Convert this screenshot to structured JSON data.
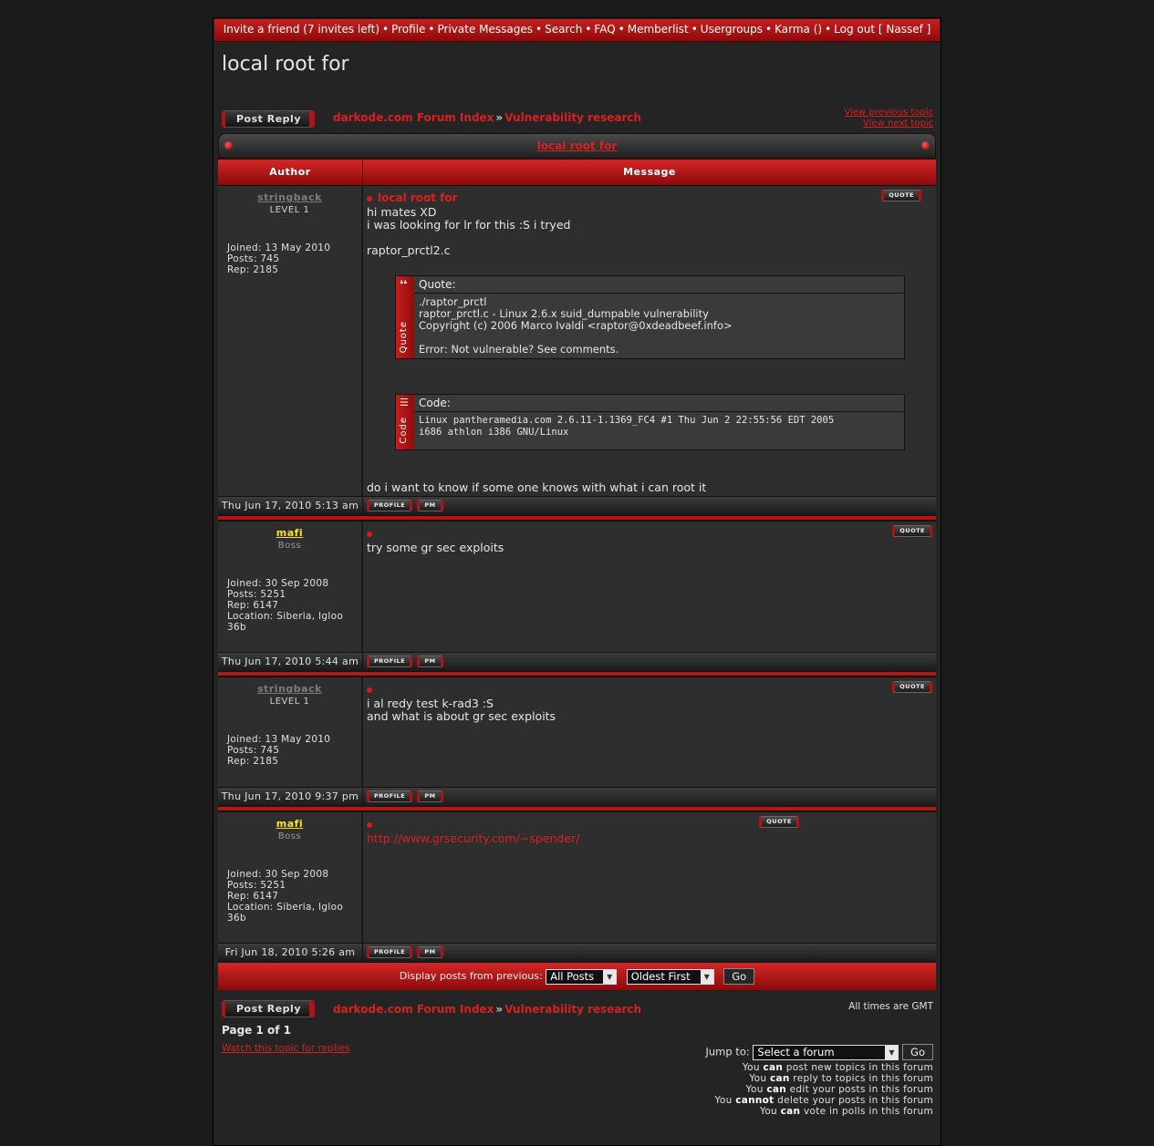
{
  "nav": {
    "items": [
      "Invite a friend (7 invites left)",
      "Profile",
      "Private Messages",
      "Search",
      "FAQ",
      "Memberlist",
      "Usergroups",
      "Karma ()",
      "Log out [ Nassef ]"
    ],
    "sep": "•"
  },
  "page_title": "local root for",
  "post_reply_label": "Post Reply",
  "breadcrumb": {
    "index": "darkode.com Forum Index",
    "arrow": "»",
    "forum": "Vulnerability research"
  },
  "topic_nav": {
    "prev": "View previous topic",
    "next": "View next topic"
  },
  "caption": "local root for",
  "headers": {
    "author": "Author",
    "message": "Message"
  },
  "buttons": {
    "quote": "QUOTE",
    "profile": "PROFILE",
    "pm": "PM"
  },
  "posts": [
    {
      "author": "stringback",
      "rank": "LEVEL 1",
      "joined": "Joined: 13 May 2010",
      "posts": "Posts: 745",
      "rep": "Rep: 2185",
      "subject": "local root for",
      "lines": [
        "hi mates XD",
        "i was looking for lr for this :S i tryed",
        "raptor_prctl2.c"
      ],
      "quote": {
        "label": "Quote:",
        "side": "Quote",
        "lines": [
          "./raptor_prctl",
          "raptor_prctl.c - Linux 2.6.x suid_dumpable vulnerability",
          "Copyright (c) 2006 Marco Ivaldi <raptor@0xdeadbeef.info>",
          "Error: Not vulnerable? See comments."
        ]
      },
      "code": {
        "label": "Code:",
        "side": "Code",
        "lines": [
          "Linux pantheramedia.com 2.6.11-1.1369_FC4 #1 Thu Jun 2 22:55:56 EDT 2005",
          "i686 athlon i386 GNU/Linux"
        ]
      },
      "closing": "do i want to know if some one knows with what i can root it",
      "date": "Thu Jun 17, 2010 5:13 am"
    },
    {
      "author": "mafi",
      "rank": "Boss",
      "joined": "Joined: 30 Sep 2008",
      "posts": "Posts: 5251",
      "rep": "Rep: 6147",
      "location": "Location: Siberia, Igloo 36b",
      "lines": [
        "try some gr sec exploits"
      ],
      "date": "Thu Jun 17, 2010 5:44 am"
    },
    {
      "author": "stringback",
      "rank": "LEVEL 1",
      "joined": "Joined: 13 May 2010",
      "posts": "Posts: 745",
      "rep": "Rep: 2185",
      "lines": [
        "i al redy test k-rad3 :S",
        "and what is about gr sec exploits"
      ],
      "date": "Thu Jun 17, 2010 9:37 pm"
    },
    {
      "author": "mafi",
      "rank": "Boss",
      "joined": "Joined: 30 Sep 2008",
      "posts": "Posts: 5251",
      "rep": "Rep: 6147",
      "location": "Location: Siberia, Igloo 36b",
      "link": "http://www.grsecurity.com/~spender/",
      "date": "Fri Jun 18, 2010 5:26 am"
    }
  ],
  "display_bar": {
    "label": "Display posts from previous:",
    "posts_value": "All Posts",
    "order_value": "Oldest First",
    "go": "Go"
  },
  "page_num": "Page 1 of 1",
  "watch": "Watch this topic for replies",
  "gmt": "All times are GMT",
  "jump": {
    "label": "Jump to:",
    "value": "Select a forum",
    "go": "Go"
  },
  "permissions": [
    [
      "You ",
      "can",
      " post new topics in this forum"
    ],
    [
      "You ",
      "can",
      " reply to topics in this forum"
    ],
    [
      "You ",
      "can",
      " edit your posts in this forum"
    ],
    [
      "You ",
      "cannot",
      " delete your posts in this forum"
    ],
    [
      "You ",
      "can",
      " vote in polls in this forum"
    ]
  ],
  "colors": {
    "accent": "#c81e1e",
    "link": "#d92020",
    "boss_name": "#ffe21c",
    "background": "#242424"
  }
}
